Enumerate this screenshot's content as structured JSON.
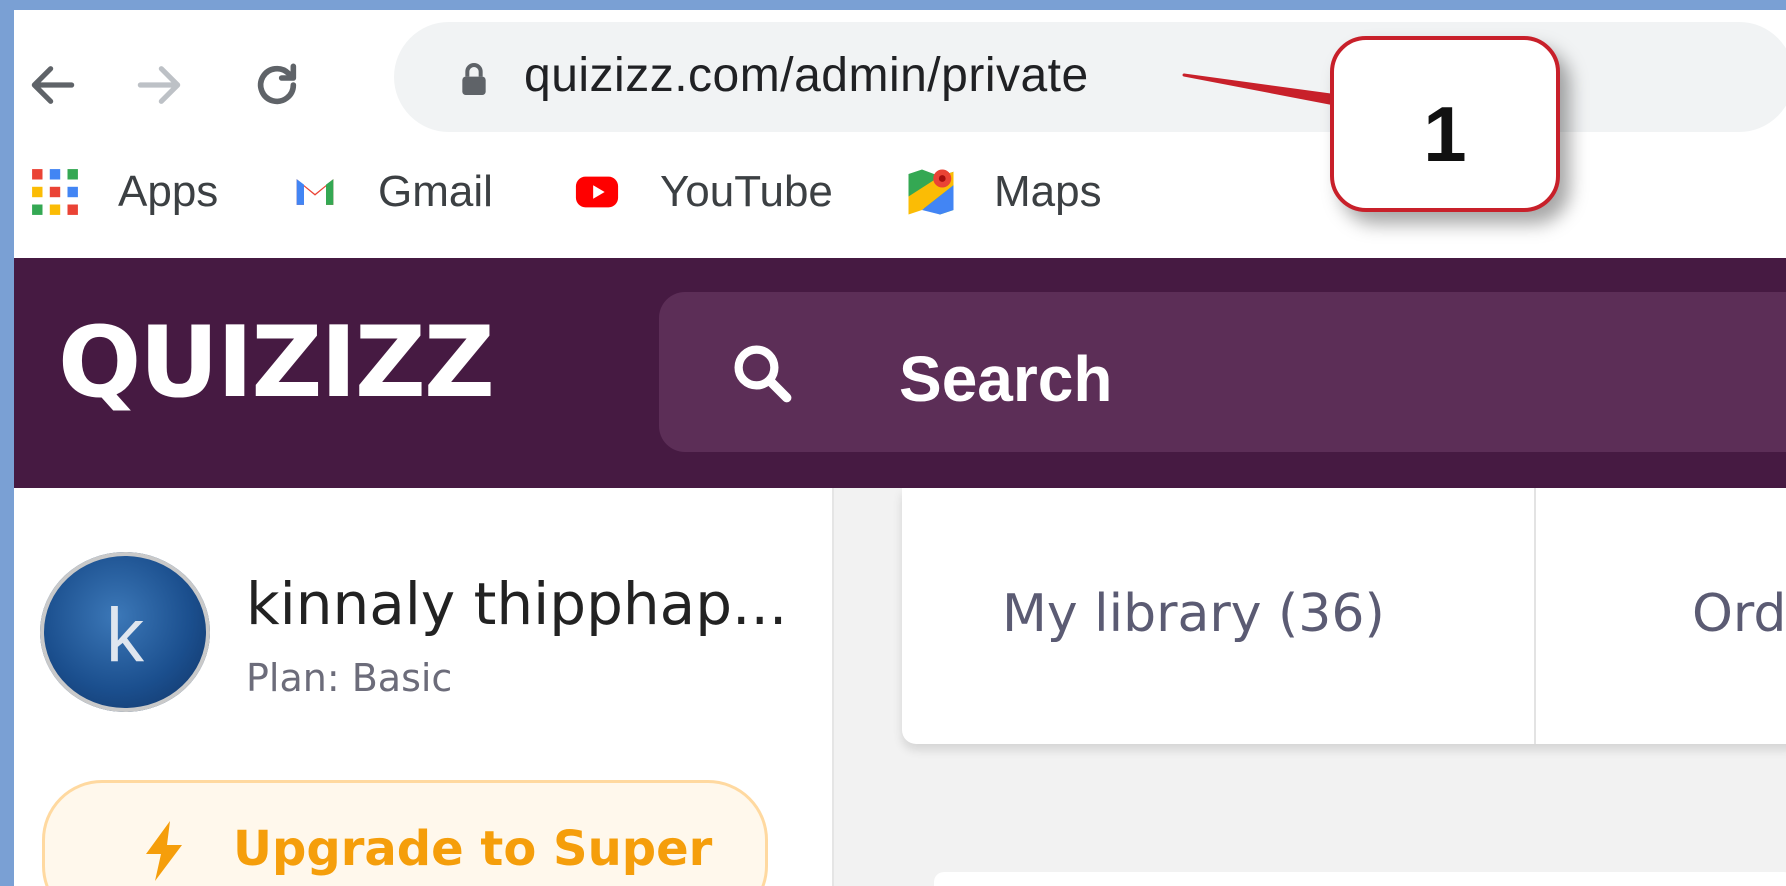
{
  "browser": {
    "url": "quizizz.com/admin/private",
    "bookmarks": [
      {
        "label": "Apps",
        "icon": "apps-grid-icon"
      },
      {
        "label": "Gmail",
        "icon": "gmail-icon"
      },
      {
        "label": "YouTube",
        "icon": "youtube-icon"
      },
      {
        "label": "Maps",
        "icon": "maps-icon"
      }
    ]
  },
  "annotation": {
    "number": "1",
    "border_color": "#c8202a"
  },
  "app": {
    "logo": "QUIZIZZ",
    "search_placeholder": "Search",
    "header_color": "#461a42"
  },
  "user": {
    "initial": "k",
    "name": "kinnaly thipphap...",
    "plan": "Plan: Basic"
  },
  "upgrade": {
    "label": "Upgrade to Super",
    "accent": "#f59e0b"
  },
  "library": {
    "tabs": [
      "My library (36)",
      "Ord"
    ]
  }
}
